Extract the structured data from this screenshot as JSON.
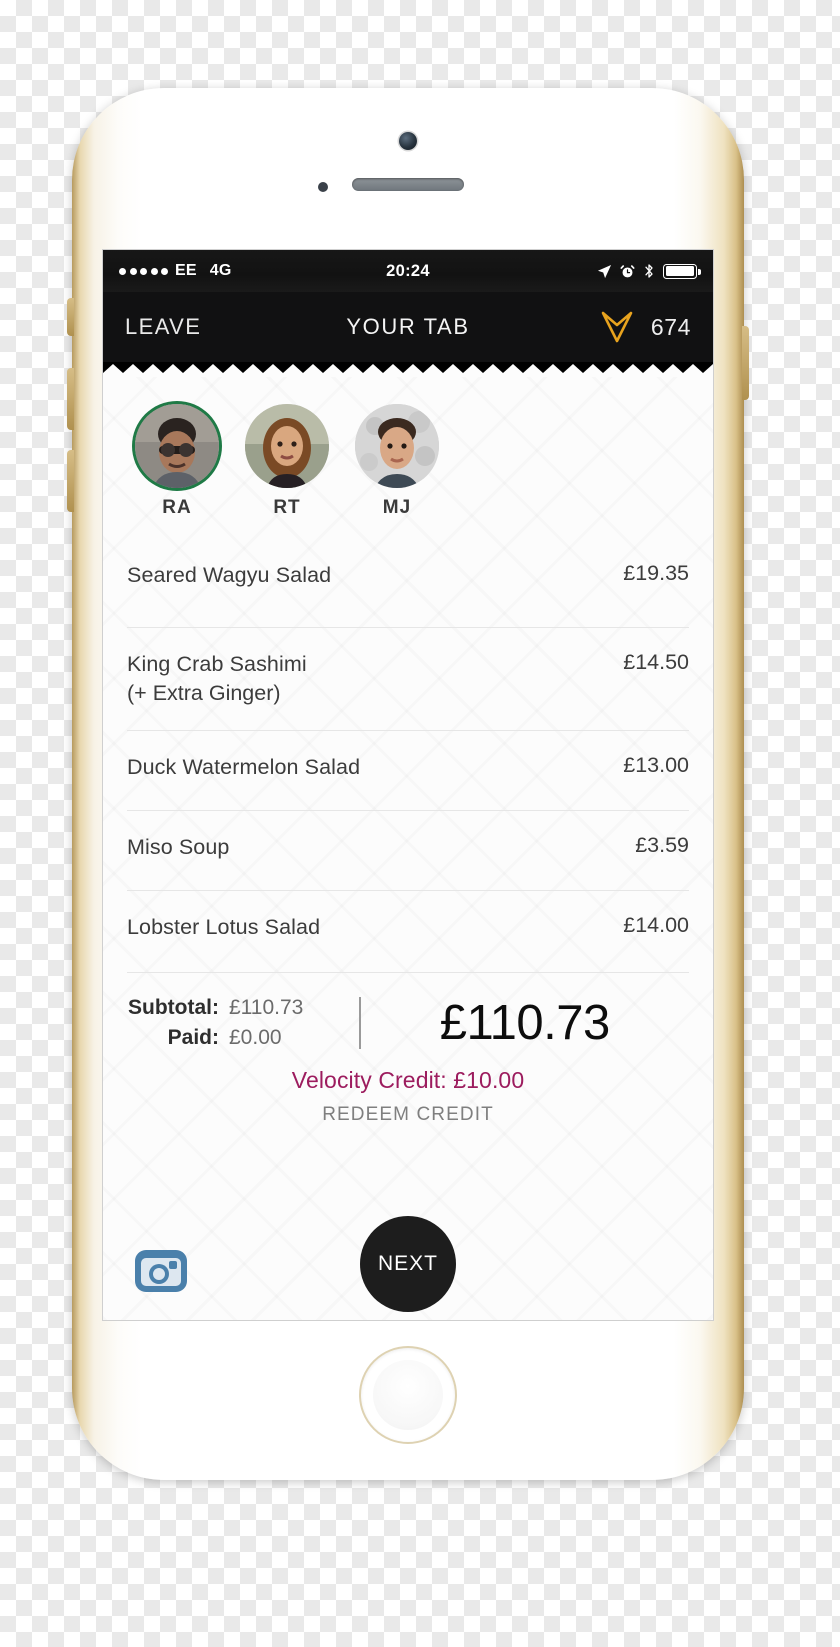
{
  "status_bar": {
    "signal_dots": 5,
    "carrier": "EE",
    "network": "4G",
    "time": "20:24",
    "icons": [
      "location-arrow-icon",
      "alarm-clock-icon",
      "bluetooth-icon",
      "battery-icon"
    ],
    "battery_level_percent": 100
  },
  "nav_bar": {
    "leave_label": "LEAVE",
    "title": "YOUR TAB",
    "logo": "velocity-chevron-logo",
    "logo_color": "#e8a31e",
    "table_number": "674"
  },
  "guests": [
    {
      "initials": "RA",
      "active": true
    },
    {
      "initials": "RT",
      "active": false
    },
    {
      "initials": "MJ",
      "active": false
    }
  ],
  "items": [
    {
      "name": "Seared Wagyu Salad",
      "modifier": "",
      "price": "£19.35"
    },
    {
      "name": "King Crab Sashimi",
      "modifier": "(+ Extra Ginger)",
      "price": "£14.50"
    },
    {
      "name": "Duck Watermelon Salad",
      "modifier": "",
      "price": "£13.00"
    },
    {
      "name": "Miso Soup",
      "modifier": "",
      "price": "£3.59"
    },
    {
      "name": "Lobster Lotus Salad",
      "modifier": "",
      "price": "£14.00"
    }
  ],
  "totals": {
    "subtotal_label": "Subtotal:",
    "subtotal_value": "£110.73",
    "paid_label": "Paid:",
    "paid_value": "£0.00",
    "grand_total": "£110.73"
  },
  "credit": {
    "line": "Velocity Credit: £10.00",
    "color": "#9c1c5e",
    "redeem_label": "REDEEM CREDIT"
  },
  "actions": {
    "instagram_label": "instagram-icon",
    "next_label": "NEXT"
  }
}
